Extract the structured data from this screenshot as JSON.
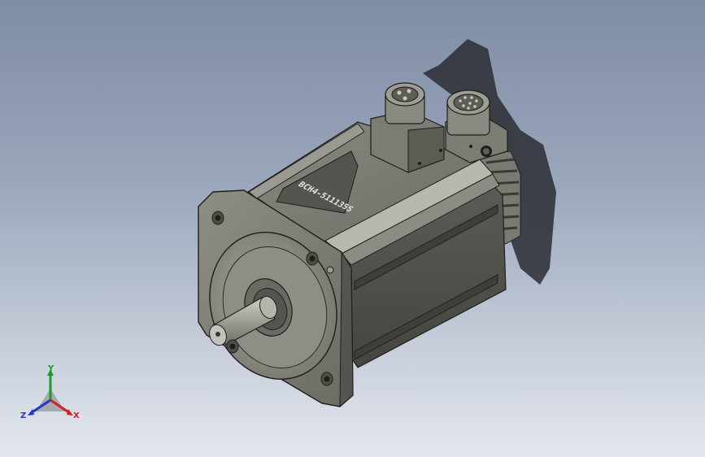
{
  "viewport": {
    "name": "3D model viewport",
    "background_top": "#7f8ca6",
    "background_bottom": "#e4e7ee"
  },
  "model": {
    "body_color": "#6f6f68",
    "nameplate_text": "BCH4-511135S"
  },
  "triad": {
    "x_label": "X",
    "y_label": "Y",
    "z_label": "Z",
    "x_color": "#d22222",
    "y_color": "#1c9a2a",
    "z_color": "#2436c8"
  }
}
